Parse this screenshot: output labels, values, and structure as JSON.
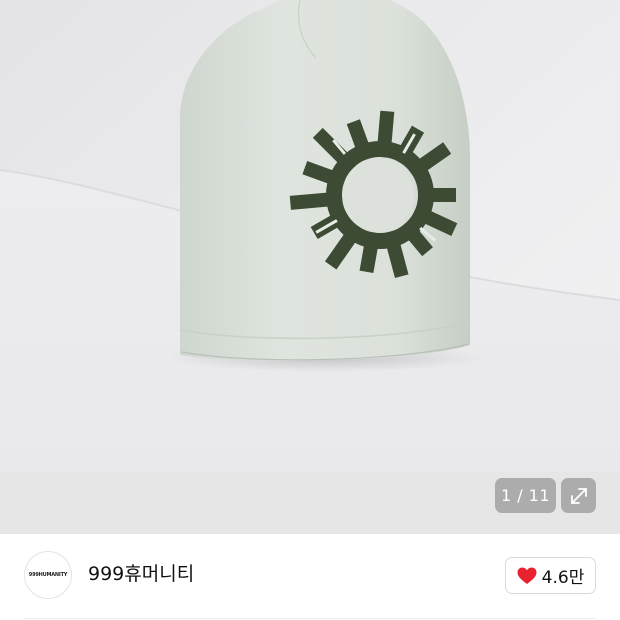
{
  "gallery": {
    "image_alt": "knit beanie product photo",
    "counter": "1 / 11",
    "expand_icon": "expand-arrows-icon"
  },
  "brand": {
    "logo_text": "999HUMANITY",
    "name": "999휴머니티",
    "like_icon": "heart-icon",
    "like_count": "4.6만",
    "like_color": "#e8232f"
  },
  "colors": {
    "beanie": "#dde3dc",
    "pattern": "#3d4a34",
    "background": "#e9e9ec"
  }
}
